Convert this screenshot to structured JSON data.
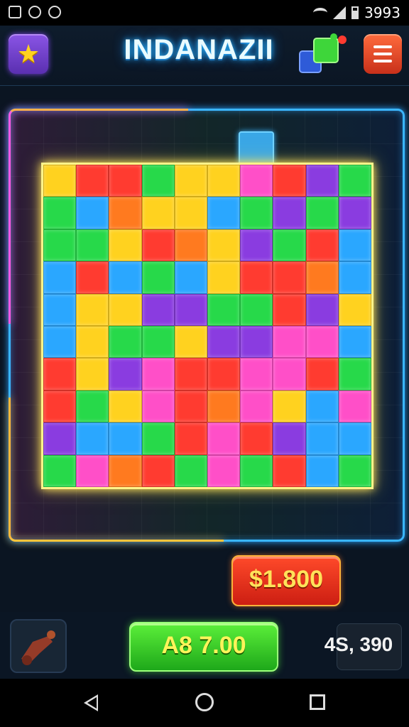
{
  "status_bar": {
    "time": "3993",
    "icons": [
      "notification-icon",
      "alarm-icon",
      "app-icon",
      "wifi-icon",
      "signal-icon",
      "battery-icon"
    ]
  },
  "header": {
    "title": "INDANAZII",
    "star_icon": "star-icon",
    "pieces_icon": "puzzle-pieces-icon",
    "menu_icon": "hamburger-menu-icon"
  },
  "board": {
    "rows": 10,
    "cols": 10,
    "palette": {
      "R": "#ff3b30",
      "G": "#27d94a",
      "B": "#2aa7ff",
      "Y": "#ffd21f",
      "P": "#8a3ce0",
      "K": "#ff4fc8",
      "O": "#ff7a1f",
      "L": "#3cf0c8"
    },
    "pieces": [
      [
        "Y",
        "R",
        "R",
        "G",
        "Y",
        "Y",
        "K",
        "R",
        "P",
        "G"
      ],
      [
        "G",
        "B",
        "O",
        "Y",
        "Y",
        "B",
        "G",
        "P",
        "G",
        "P"
      ],
      [
        "G",
        "G",
        "Y",
        "R",
        "O",
        "Y",
        "P",
        "G",
        "R",
        "B"
      ],
      [
        "B",
        "R",
        "B",
        "G",
        "B",
        "Y",
        "R",
        "R",
        "O",
        "B"
      ],
      [
        "B",
        "Y",
        "Y",
        "P",
        "P",
        "G",
        "G",
        "R",
        "P",
        "Y"
      ],
      [
        "B",
        "Y",
        "G",
        "G",
        "Y",
        "P",
        "P",
        "K",
        "K",
        "B"
      ],
      [
        "R",
        "Y",
        "P",
        "K",
        "R",
        "R",
        "K",
        "K",
        "R",
        "G"
      ],
      [
        "R",
        "G",
        "Y",
        "K",
        "R",
        "O",
        "K",
        "Y",
        "B",
        "K"
      ],
      [
        "P",
        "B",
        "B",
        "G",
        "R",
        "K",
        "R",
        "P",
        "B",
        "B"
      ],
      [
        "G",
        "K",
        "O",
        "R",
        "G",
        "K",
        "G",
        "R",
        "B",
        "G"
      ]
    ],
    "loose_piece_color": "#3aa7e6"
  },
  "price_button": {
    "label": "$1.800"
  },
  "bottom_bar": {
    "booster_icon": "cannon-booster-icon",
    "play_label": "A8 7.00",
    "score": "4S, 390"
  },
  "nav": {
    "back_icon": "back-icon",
    "home_icon": "home-icon",
    "recent_icon": "recent-apps-icon"
  }
}
